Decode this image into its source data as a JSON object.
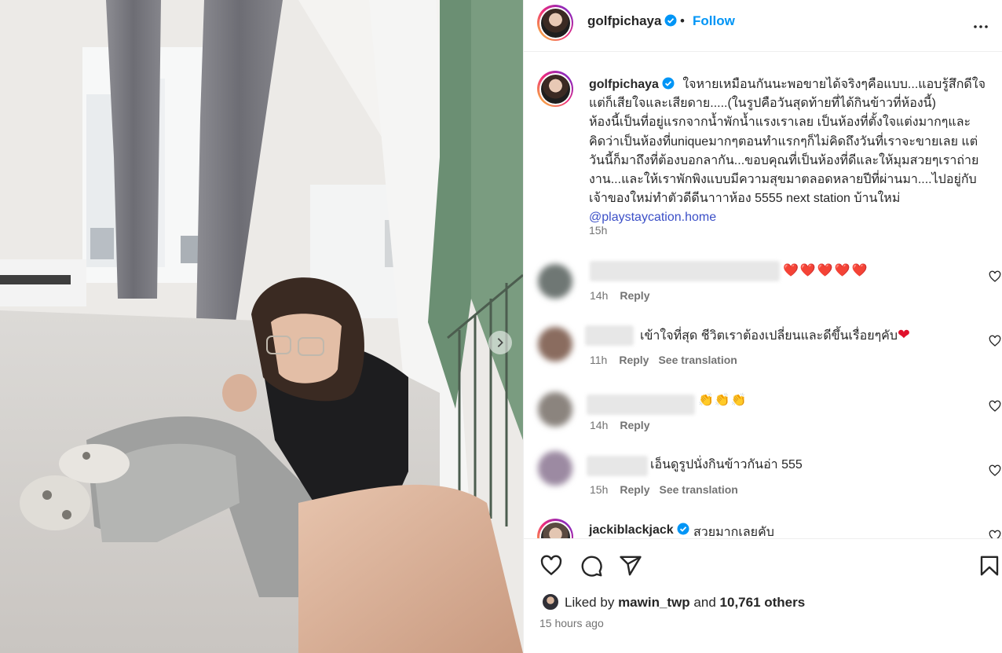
{
  "header": {
    "username": "golfpichaya",
    "separator": "•",
    "follow_label": "Follow",
    "more_icon": "more-horizontal-icon"
  },
  "caption": {
    "username": "golfpichaya",
    "lines": [
      "ใจหายเหมือนกันนะพอขายได้จริงๆคือแบบ...แอบรู้สึกดีใจ",
      "แต่ก็เสียใจและเสียดาย.....(ในรูปคือวันสุดท้ายที่ได้กินข้าวที่ห้องนี้)",
      "ห้องนี้เป็นที่อยู่แรกจากน้ำพักน้ำแรงเราเลย เป็นห้องที่ตั้งใจแต่งมากๆและ",
      "คิดว่าเป็นห้องที่uniqueมากๆตอนทำแรกๆก็ไม่คิดถึงวันที่เราจะขายเลย แต่",
      "วันนี้ก็มาถึงที่ต้องบอกลากัน...ขอบคุณที่เป็นห้องที่ดีและให้มุมสวยๆเราถ่าย",
      "งาน...และให้เราพักพิงแบบมีความสุขมาตลอดหลายปีที่ผ่านมา....ไปอยู่กับ",
      "เจ้าของใหม่ทำตัวดีดีนาาาห้อง 5555 next station บ้านใหม่"
    ],
    "mention": "@playstaycation.home",
    "time": "15h"
  },
  "comments": [
    {
      "text": "❤️❤️❤️❤️❤️",
      "time": "14h",
      "reply": "Reply",
      "see_translation": ""
    },
    {
      "text": "เข้าใจที่สุด ชีวิตเราต้องเปลี่ยนและดีขึ้นเรื่อยๆคับ",
      "emoji": "❤",
      "time": "11h",
      "reply": "Reply",
      "see_translation": "See translation"
    },
    {
      "text": "👏👏👏",
      "time": "14h",
      "reply": "Reply",
      "see_translation": ""
    },
    {
      "text": "เอ็นดูรูปนั่งกินข้าวกันอ่า 555",
      "time": "15h",
      "reply": "Reply",
      "see_translation": "See translation"
    },
    {
      "username": "jackiblackjack",
      "text": "สวยมากเลยคับ"
    }
  ],
  "actions": {
    "like_icon": "heart-outline-icon",
    "comment_icon": "comment-icon",
    "share_icon": "share-paper-plane-icon",
    "save_icon": "bookmark-icon"
  },
  "likes": {
    "prefix": "Liked by",
    "user": "mawin_twp",
    "and": "and",
    "others": "10,761 others"
  },
  "posted_ago": "15 hours ago",
  "colors": {
    "link_blue": "#0095f6",
    "mention_blue": "#3b4fc7",
    "verified_blue": "#0095f6",
    "meta_gray": "#737373"
  }
}
